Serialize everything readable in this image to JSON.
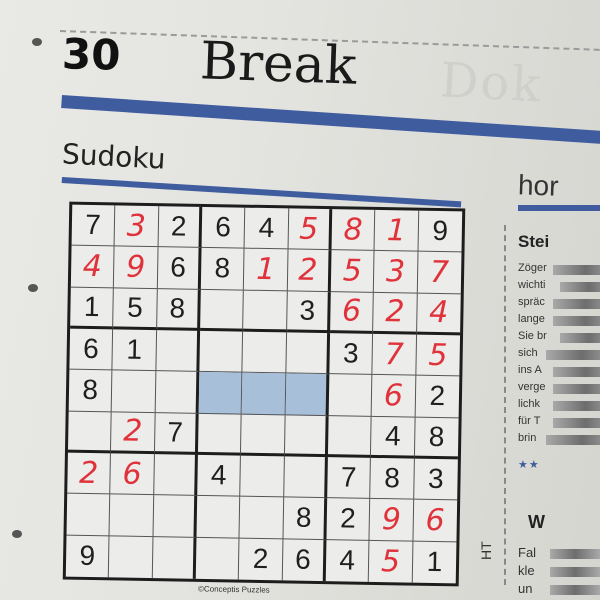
{
  "header": {
    "page_number": "30",
    "section_title": "Break",
    "ghost_word": "Dok"
  },
  "puzzle": {
    "title": "Sudoku",
    "credit": "©Conceptis Puzzles",
    "grid": [
      [
        "7",
        "3",
        "2",
        "6",
        "4",
        "5",
        "8",
        "1",
        "9"
      ],
      [
        "4",
        "9",
        "6",
        "8",
        "1",
        "2",
        "5",
        "3",
        "7"
      ],
      [
        "1",
        "5",
        "8",
        "",
        "",
        "3",
        "6",
        "2",
        "4"
      ],
      [
        "6",
        "1",
        "",
        "",
        "",
        "",
        "3",
        "7",
        "5"
      ],
      [
        "8",
        "",
        "",
        "",
        "",
        "",
        "",
        "6",
        "2"
      ],
      [
        "",
        "2",
        "7",
        "",
        "",
        "",
        "",
        "4",
        "8"
      ],
      [
        "2",
        "6",
        "",
        "4",
        "",
        "",
        "7",
        "8",
        "3"
      ],
      [
        "",
        "",
        "",
        "",
        "",
        "8",
        "2",
        "9",
        "6"
      ],
      [
        "9",
        "",
        "",
        "",
        "2",
        "6",
        "4",
        "5",
        "1"
      ]
    ],
    "handwritten": [
      [
        false,
        true,
        false,
        false,
        false,
        true,
        true,
        true,
        false
      ],
      [
        true,
        true,
        false,
        false,
        true,
        true,
        true,
        true,
        true
      ],
      [
        false,
        false,
        false,
        false,
        false,
        false,
        true,
        true,
        true
      ],
      [
        false,
        false,
        false,
        false,
        false,
        false,
        false,
        true,
        true
      ],
      [
        false,
        false,
        false,
        false,
        false,
        false,
        false,
        true,
        false
      ],
      [
        false,
        true,
        false,
        false,
        false,
        false,
        false,
        false,
        false
      ],
      [
        true,
        true,
        false,
        false,
        false,
        false,
        false,
        false,
        false
      ],
      [
        false,
        false,
        false,
        false,
        false,
        false,
        false,
        true,
        true
      ],
      [
        false,
        false,
        false,
        false,
        false,
        false,
        false,
        true,
        false
      ]
    ],
    "shaded_cells": [
      [
        4,
        3
      ],
      [
        4,
        4
      ],
      [
        4,
        5
      ]
    ],
    "colors": {
      "printed_digit": "#1f1f1f",
      "handwritten_digit": "#e0323a",
      "accent_bar": "#3e5c9e",
      "shade": "#a7bfd8"
    }
  },
  "right_column": {
    "section_word": "hor",
    "heading": "Stei",
    "lines": [
      "Zöger",
      "wichti",
      "spräc",
      "lange",
      "Sie br",
      "sich",
      "ins A",
      "verge",
      "lichk",
      "für T",
      "brin"
    ],
    "heading2": "W",
    "lines2": [
      "Fal",
      "kle",
      "un"
    ]
  },
  "side_text": "HT"
}
